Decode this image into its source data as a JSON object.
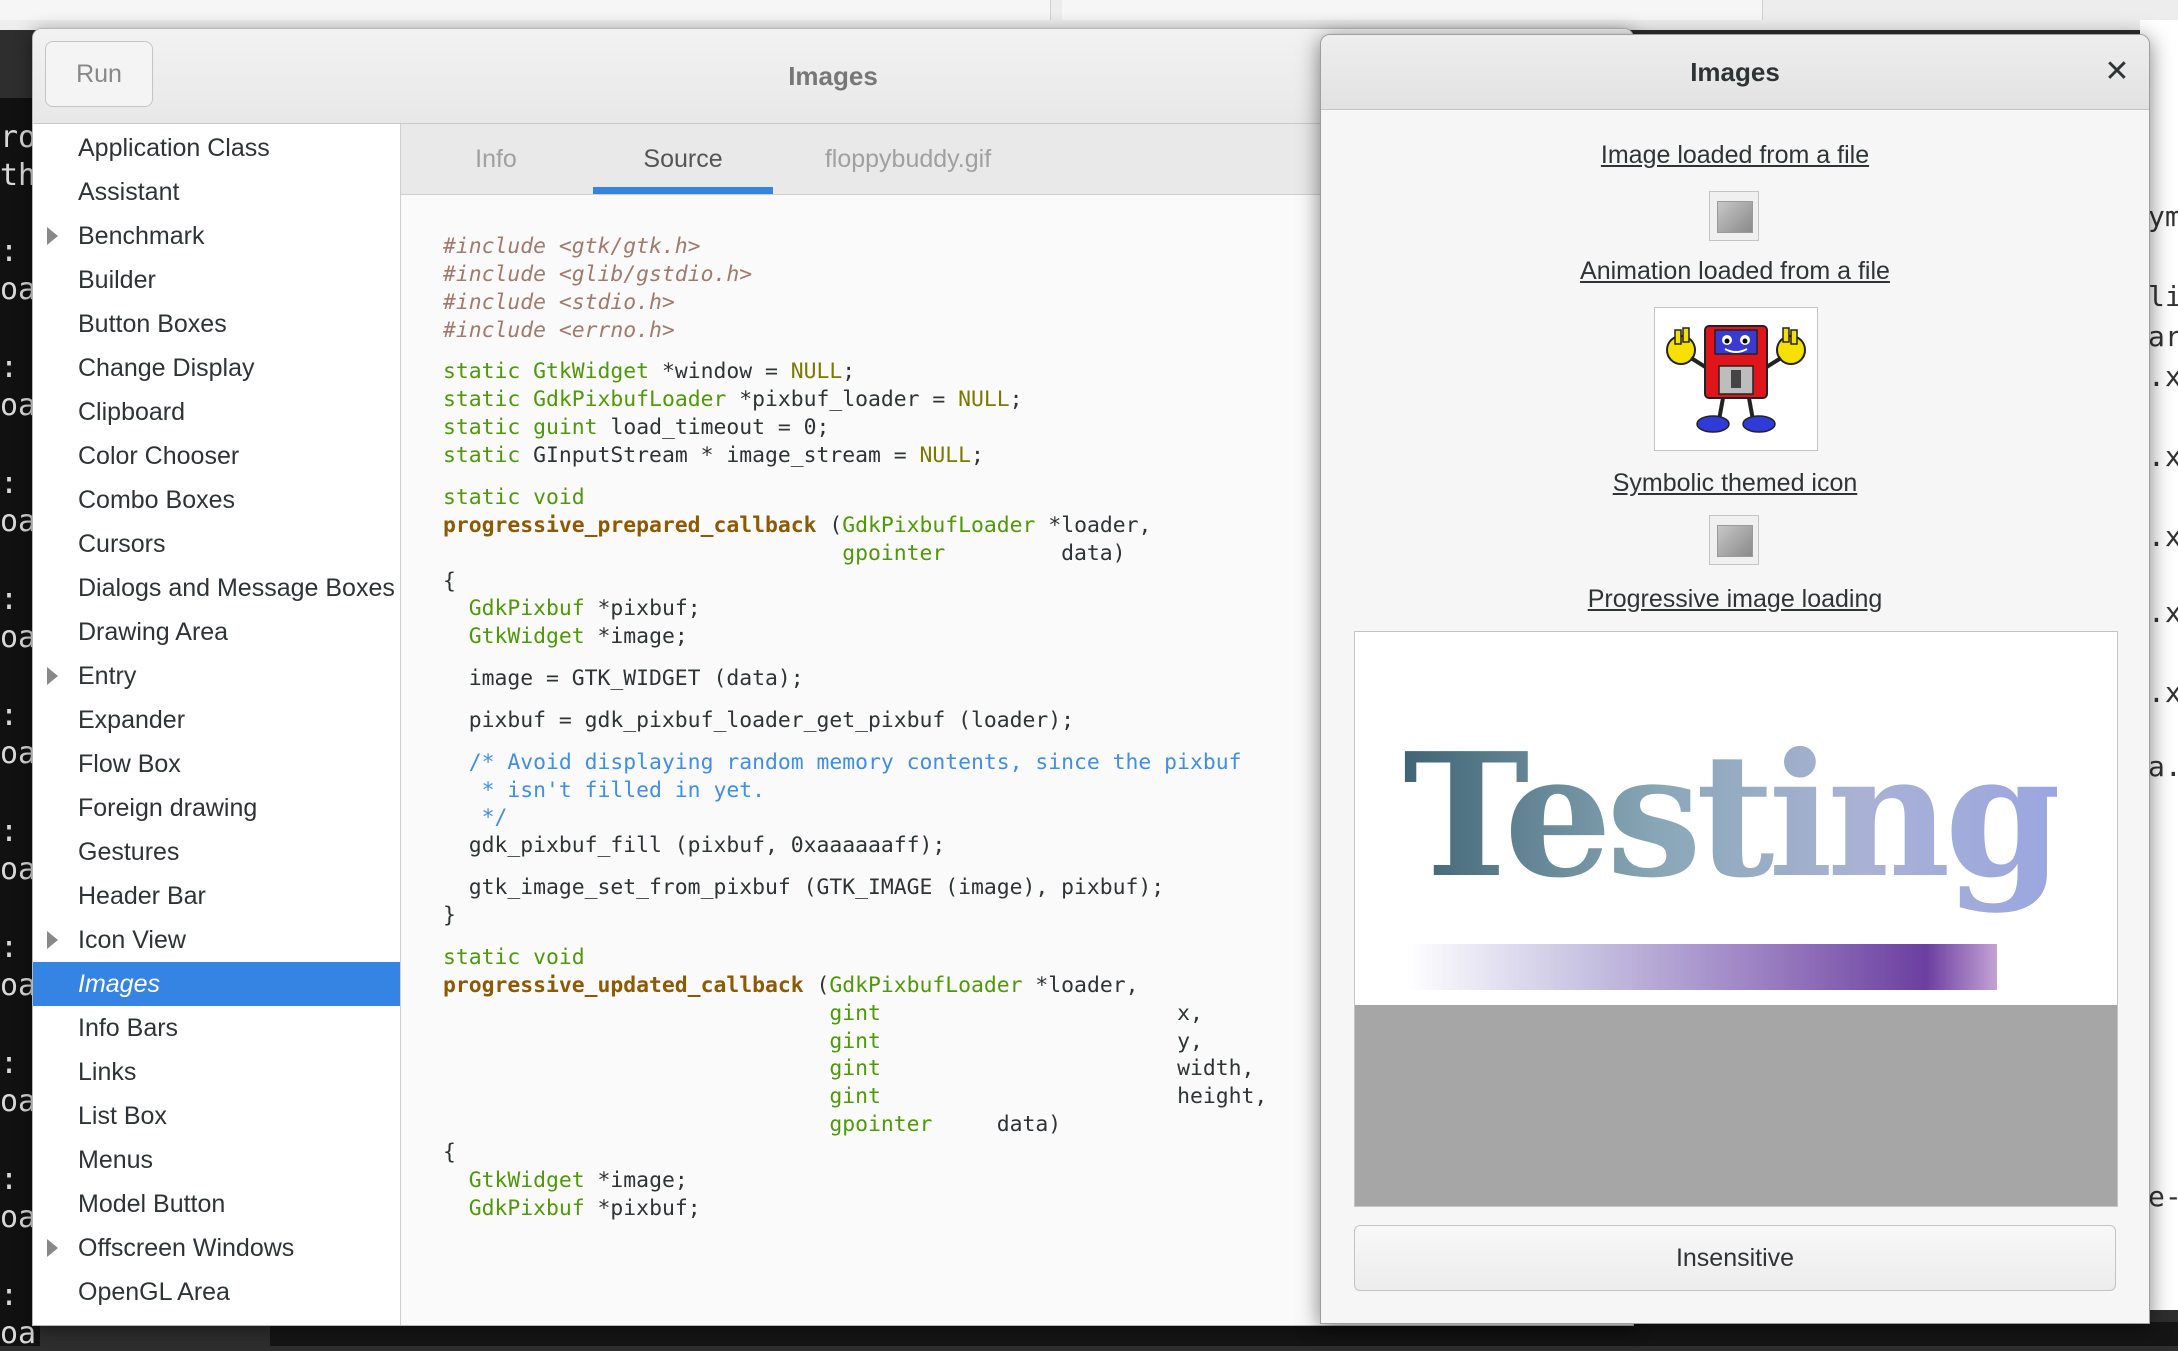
{
  "main_window": {
    "title": "Images",
    "run_label": "Run",
    "tabs": [
      {
        "label": "Info",
        "active": false
      },
      {
        "label": "Source",
        "active": true
      },
      {
        "label": "floppybuddy.gif",
        "active": false
      }
    ],
    "sidebar": [
      {
        "label": "Application Class",
        "expandable": false,
        "selected": false
      },
      {
        "label": "Assistant",
        "expandable": false,
        "selected": false
      },
      {
        "label": "Benchmark",
        "expandable": true,
        "selected": false
      },
      {
        "label": "Builder",
        "expandable": false,
        "selected": false
      },
      {
        "label": "Button Boxes",
        "expandable": false,
        "selected": false
      },
      {
        "label": "Change Display",
        "expandable": false,
        "selected": false
      },
      {
        "label": "Clipboard",
        "expandable": false,
        "selected": false
      },
      {
        "label": "Color Chooser",
        "expandable": false,
        "selected": false
      },
      {
        "label": "Combo Boxes",
        "expandable": false,
        "selected": false
      },
      {
        "label": "Cursors",
        "expandable": false,
        "selected": false
      },
      {
        "label": "Dialogs and Message Boxes",
        "expandable": false,
        "selected": false
      },
      {
        "label": "Drawing Area",
        "expandable": false,
        "selected": false
      },
      {
        "label": "Entry",
        "expandable": true,
        "selected": false
      },
      {
        "label": "Expander",
        "expandable": false,
        "selected": false
      },
      {
        "label": "Flow Box",
        "expandable": false,
        "selected": false
      },
      {
        "label": "Foreign drawing",
        "expandable": false,
        "selected": false
      },
      {
        "label": "Gestures",
        "expandable": false,
        "selected": false
      },
      {
        "label": "Header Bar",
        "expandable": false,
        "selected": false
      },
      {
        "label": "Icon View",
        "expandable": true,
        "selected": false
      },
      {
        "label": "Images",
        "expandable": false,
        "selected": true
      },
      {
        "label": "Info Bars",
        "expandable": false,
        "selected": false
      },
      {
        "label": "Links",
        "expandable": false,
        "selected": false
      },
      {
        "label": "List Box",
        "expandable": false,
        "selected": false
      },
      {
        "label": "Menus",
        "expandable": false,
        "selected": false
      },
      {
        "label": "Model Button",
        "expandable": false,
        "selected": false
      },
      {
        "label": "Offscreen Windows",
        "expandable": true,
        "selected": false
      },
      {
        "label": "OpenGL Area",
        "expandable": false,
        "selected": false
      }
    ],
    "source_lines": [
      [
        [
          "pp",
          "#include <gtk/gtk.h>"
        ]
      ],
      [
        [
          "pp",
          "#include <glib/gstdio.h>"
        ]
      ],
      [
        [
          "pp",
          "#include <stdio.h>"
        ]
      ],
      [
        [
          "pp",
          "#include <errno.h>"
        ]
      ],
      [],
      [
        [
          "kw",
          "static "
        ],
        [
          "kw",
          "GtkWidget"
        ],
        [
          "tx",
          " *window = "
        ],
        [
          "nl",
          "NULL"
        ],
        [
          "tx",
          ";"
        ]
      ],
      [
        [
          "kw",
          "static "
        ],
        [
          "kw",
          "GdkPixbufLoader"
        ],
        [
          "tx",
          " *pixbuf_loader = "
        ],
        [
          "nl",
          "NULL"
        ],
        [
          "tx",
          ";"
        ]
      ],
      [
        [
          "kw",
          "static "
        ],
        [
          "kw",
          "guint"
        ],
        [
          "tx",
          " load_timeout = 0;"
        ]
      ],
      [
        [
          "kw",
          "static "
        ],
        [
          "tx",
          "GInputStream * image_stream = "
        ],
        [
          "nl",
          "NULL"
        ],
        [
          "tx",
          ";"
        ]
      ],
      [],
      [
        [
          "kw",
          "static void"
        ]
      ],
      [
        [
          "fn",
          "progressive_prepared_callback"
        ],
        [
          "tx",
          " ("
        ],
        [
          "kw",
          "GdkPixbufLoader"
        ],
        [
          "tx",
          " *loader,"
        ]
      ],
      [
        [
          "tx",
          "                               "
        ],
        [
          "kw",
          "gpointer"
        ],
        [
          "tx",
          "         data)"
        ]
      ],
      [
        [
          "tx",
          "{"
        ]
      ],
      [
        [
          "tx",
          "  "
        ],
        [
          "kw",
          "GdkPixbuf"
        ],
        [
          "tx",
          " *pixbuf;"
        ]
      ],
      [
        [
          "tx",
          "  "
        ],
        [
          "kw",
          "GtkWidget"
        ],
        [
          "tx",
          " *image;"
        ]
      ],
      [],
      [
        [
          "tx",
          "  image = GTK_WIDGET (data);"
        ]
      ],
      [],
      [
        [
          "tx",
          "  pixbuf = gdk_pixbuf_loader_get_pixbuf (loader);"
        ]
      ],
      [],
      [
        [
          "cm",
          "  /* Avoid displaying random memory contents, since the pixbuf"
        ]
      ],
      [
        [
          "cm",
          "   * isn't filled in yet."
        ]
      ],
      [
        [
          "cm",
          "   */"
        ]
      ],
      [
        [
          "tx",
          "  gdk_pixbuf_fill (pixbuf, 0xaaaaaaff);"
        ]
      ],
      [],
      [
        [
          "tx",
          "  gtk_image_set_from_pixbuf (GTK_IMAGE (image), pixbuf);"
        ]
      ],
      [
        [
          "tx",
          "}"
        ]
      ],
      [],
      [
        [
          "kw",
          "static void"
        ]
      ],
      [
        [
          "fn",
          "progressive_updated_callback"
        ],
        [
          "tx",
          " ("
        ],
        [
          "kw",
          "GdkPixbufLoader"
        ],
        [
          "tx",
          " *loader,"
        ]
      ],
      [
        [
          "tx",
          "                              "
        ],
        [
          "kw",
          "gint"
        ],
        [
          "tx",
          "                       x,"
        ]
      ],
      [
        [
          "tx",
          "                              "
        ],
        [
          "kw",
          "gint"
        ],
        [
          "tx",
          "                       y,"
        ]
      ],
      [
        [
          "tx",
          "                              "
        ],
        [
          "kw",
          "gint"
        ],
        [
          "tx",
          "                       width,"
        ]
      ],
      [
        [
          "tx",
          "                              "
        ],
        [
          "kw",
          "gint"
        ],
        [
          "tx",
          "                       height,"
        ]
      ],
      [
        [
          "tx",
          "                              "
        ],
        [
          "kw",
          "gpointer"
        ],
        [
          "tx",
          "     data)"
        ]
      ],
      [
        [
          "tx",
          "{"
        ]
      ],
      [
        [
          "tx",
          "  "
        ],
        [
          "kw",
          "GtkWidget"
        ],
        [
          "tx",
          " *image;"
        ]
      ],
      [
        [
          "tx",
          "  "
        ],
        [
          "kw",
          "GdkPixbuf"
        ],
        [
          "tx",
          " *pixbuf;"
        ]
      ]
    ]
  },
  "demo_window": {
    "title": "Images",
    "close_icon": "close-icon",
    "labels": {
      "file_image": "Image loaded from a file",
      "animation": "Animation loaded from a file",
      "symbolic": "Symbolic themed icon",
      "progressive": "Progressive image loading"
    },
    "progressive_text": "Testing",
    "progressive_fraction_loaded": 0.65,
    "insensitive_label": "Insensitive"
  },
  "colors": {
    "accent": "#3584e4",
    "keyword": "#4e9a06",
    "function": "#8f5902",
    "comment": "#3f8ee8",
    "preprocessor": "#a3796b"
  }
}
